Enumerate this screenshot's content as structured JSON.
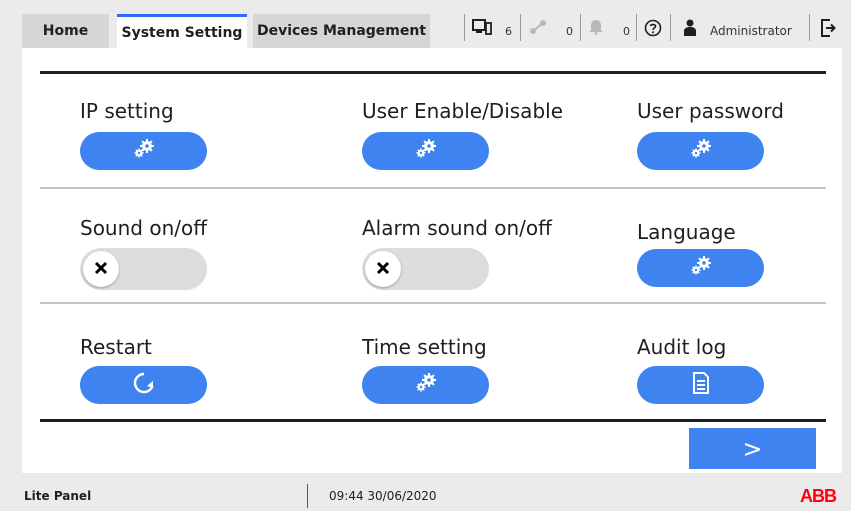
{
  "tabs": {
    "home": "Home",
    "system_setting": "System Setting",
    "devices_management": "Devices Management"
  },
  "status": {
    "devices_count": "6",
    "connections_count": "0",
    "alarms_count": "0",
    "user": "Administrator"
  },
  "settings": {
    "ip_setting": "IP setting",
    "user_enable": "User Enable/Disable",
    "user_password": "User password",
    "sound": "Sound on/off",
    "alarm_sound": "Alarm sound on/off",
    "language": "Language",
    "restart": "Restart",
    "time_setting": "Time setting",
    "audit_log": "Audit log"
  },
  "toggles": {
    "sound_on": false,
    "alarm_sound_on": false
  },
  "next_label": ">",
  "footer": {
    "panel_name": "Lite Panel",
    "datetime": "09:44 30/06/2020",
    "brand": "ABB"
  },
  "colors": {
    "accent": "#3f83f0",
    "active_tab_border": "#3366ff",
    "brand_red": "#ff000f"
  },
  "icons": {
    "settings_button": "gears-icon",
    "restart_button": "restart-icon",
    "audit_log_button": "document-icon",
    "toggle_knob": "x-icon"
  }
}
